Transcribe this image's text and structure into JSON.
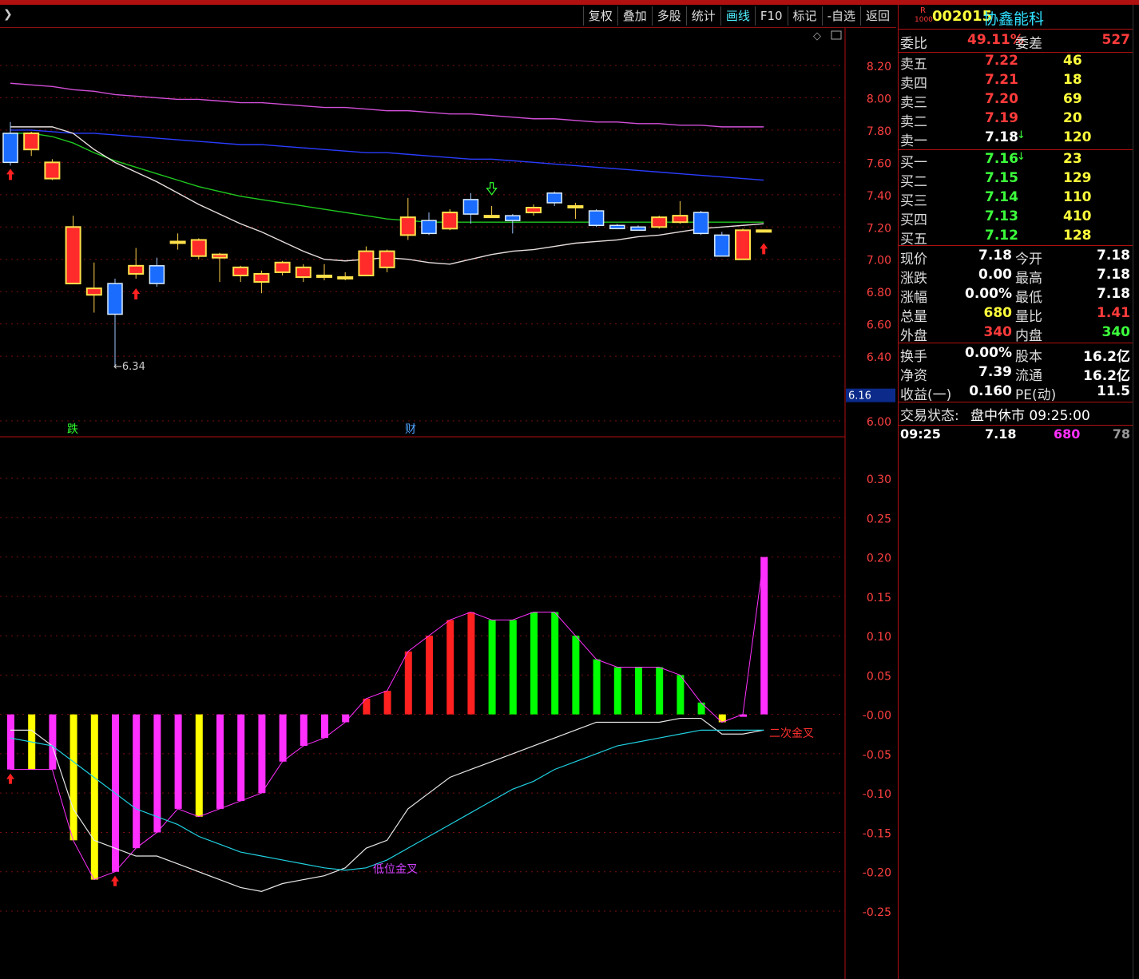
{
  "toolbar": {
    "buttons": [
      "复权",
      "叠加",
      "多股",
      "统计",
      "画线",
      "F10",
      "标记",
      "-自选",
      "返回"
    ],
    "active_index": 4
  },
  "stock": {
    "badge_top": "R",
    "badge_bottom": "1000",
    "code": "002015",
    "name": "协鑫能科"
  },
  "quote": {
    "weibi_label": "委比",
    "weibi": "49.11%",
    "weicha_label": "委差",
    "weicha": "527",
    "asks": [
      {
        "label": "卖五",
        "price": "7.22",
        "vol": "46"
      },
      {
        "label": "卖四",
        "price": "7.21",
        "vol": "18"
      },
      {
        "label": "卖三",
        "price": "7.20",
        "vol": "69"
      },
      {
        "label": "卖二",
        "price": "7.19",
        "vol": "20"
      },
      {
        "label": "卖一",
        "price": "7.18",
        "vol": "120"
      }
    ],
    "bids": [
      {
        "label": "买一",
        "price": "7.16",
        "vol": "23"
      },
      {
        "label": "买二",
        "price": "7.15",
        "vol": "129"
      },
      {
        "label": "买三",
        "price": "7.14",
        "vol": "110"
      },
      {
        "label": "买四",
        "price": "7.13",
        "vol": "410"
      },
      {
        "label": "买五",
        "price": "7.12",
        "vol": "128"
      }
    ],
    "stats1": [
      {
        "l1": "现价",
        "v1": "7.18",
        "c1": "white",
        "l2": "今开",
        "v2": "7.18",
        "c2": "white"
      },
      {
        "l1": "涨跌",
        "v1": "0.00",
        "c1": "white",
        "l2": "最高",
        "v2": "7.18",
        "c2": "white"
      },
      {
        "l1": "涨幅",
        "v1": "0.00%",
        "c1": "white",
        "l2": "最低",
        "v2": "7.18",
        "c2": "white"
      },
      {
        "l1": "总量",
        "v1": "680",
        "c1": "yellow",
        "l2": "量比",
        "v2": "1.41",
        "c2": "red"
      },
      {
        "l1": "外盘",
        "v1": "340",
        "c1": "red",
        "l2": "内盘",
        "v2": "340",
        "c2": "green"
      }
    ],
    "stats2": [
      {
        "l1": "换手",
        "v1": "0.00%",
        "c1": "white",
        "l2": "股本",
        "v2": "16.2亿",
        "c2": "white"
      },
      {
        "l1": "净资",
        "v1": "7.39",
        "c1": "white",
        "l2": "流通",
        "v2": "16.2亿",
        "c2": "white"
      },
      {
        "l1": "收益(一)",
        "v1": "0.160",
        "c1": "white",
        "l2": "PE(动)",
        "v2": "11.5",
        "c2": "white"
      }
    ],
    "status_label": "交易状态:",
    "status_value": "盘中休市 09:25:00",
    "tick": {
      "time": "09:25",
      "price": "7.18",
      "vol": "680",
      "num": "78"
    }
  },
  "chart_data": [
    {
      "type": "candlestick",
      "ylim": [
        5.95,
        8.35
      ],
      "yticks": [
        "8.20",
        "8.00",
        "7.80",
        "7.60",
        "7.40",
        "7.20",
        "7.00",
        "6.80",
        "6.60",
        "6.40",
        "6.16",
        "6.00"
      ],
      "current_price_label": "6.16",
      "low_annotation": "6.34",
      "markers": [
        "跌",
        "财"
      ],
      "candles": [
        {
          "o": 7.78,
          "c": 7.6,
          "h": 7.85,
          "l": 7.58
        },
        {
          "o": 7.68,
          "c": 7.78,
          "h": 7.79,
          "l": 7.64
        },
        {
          "o": 7.5,
          "c": 7.6,
          "h": 7.62,
          "l": 7.49
        },
        {
          "o": 6.85,
          "c": 7.2,
          "h": 7.27,
          "l": 6.85
        },
        {
          "o": 6.78,
          "c": 6.82,
          "h": 6.98,
          "l": 6.67
        },
        {
          "o": 6.85,
          "c": 6.66,
          "h": 6.88,
          "l": 6.34
        },
        {
          "o": 6.91,
          "c": 6.96,
          "h": 7.07,
          "l": 6.88
        },
        {
          "o": 6.96,
          "c": 6.85,
          "h": 7.01,
          "l": 6.83
        },
        {
          "o": 7.11,
          "c": 7.11,
          "h": 7.16,
          "l": 7.06
        },
        {
          "o": 7.02,
          "c": 7.12,
          "h": 7.13,
          "l": 7.0
        },
        {
          "o": 7.01,
          "c": 7.03,
          "h": 7.04,
          "l": 6.86
        },
        {
          "o": 6.9,
          "c": 6.95,
          "h": 6.96,
          "l": 6.86
        },
        {
          "o": 6.86,
          "c": 6.91,
          "h": 6.93,
          "l": 6.79
        },
        {
          "o": 6.92,
          "c": 6.98,
          "h": 6.99,
          "l": 6.9
        },
        {
          "o": 6.89,
          "c": 6.95,
          "h": 6.97,
          "l": 6.86
        },
        {
          "o": 6.9,
          "c": 6.9,
          "h": 6.97,
          "l": 6.87
        },
        {
          "o": 6.89,
          "c": 6.89,
          "h": 6.92,
          "l": 6.87
        },
        {
          "o": 6.9,
          "c": 7.05,
          "h": 7.08,
          "l": 6.9
        },
        {
          "o": 6.95,
          "c": 7.05,
          "h": 7.06,
          "l": 6.92
        },
        {
          "o": 7.15,
          "c": 7.26,
          "h": 7.38,
          "l": 7.12
        },
        {
          "o": 7.24,
          "c": 7.16,
          "h": 7.29,
          "l": 7.15
        },
        {
          "o": 7.19,
          "c": 7.29,
          "h": 7.31,
          "l": 7.18
        },
        {
          "o": 7.37,
          "c": 7.28,
          "h": 7.41,
          "l": 7.22
        },
        {
          "o": 7.27,
          "c": 7.27,
          "h": 7.33,
          "l": 7.26
        },
        {
          "o": 7.27,
          "c": 7.24,
          "h": 7.28,
          "l": 7.16
        },
        {
          "o": 7.29,
          "c": 7.32,
          "h": 7.34,
          "l": 7.27
        },
        {
          "o": 7.41,
          "c": 7.35,
          "h": 7.42,
          "l": 7.33
        },
        {
          "o": 7.33,
          "c": 7.33,
          "h": 7.35,
          "l": 7.25
        },
        {
          "o": 7.3,
          "c": 7.21,
          "h": 7.31,
          "l": 7.2
        },
        {
          "o": 7.21,
          "c": 7.19,
          "h": 7.22,
          "l": 7.19
        },
        {
          "o": 7.2,
          "c": 7.18,
          "h": 7.21,
          "l": 7.18
        },
        {
          "o": 7.2,
          "c": 7.26,
          "h": 7.27,
          "l": 7.19
        },
        {
          "o": 7.23,
          "c": 7.27,
          "h": 7.36,
          "l": 7.22
        },
        {
          "o": 7.29,
          "c": 7.16,
          "h": 7.3,
          "l": 7.15
        },
        {
          "o": 7.15,
          "c": 7.02,
          "h": 7.17,
          "l": 7.02
        },
        {
          "o": 7.0,
          "c": 7.18,
          "h": 7.19,
          "l": 7.0
        },
        {
          "o": 7.18,
          "c": 7.18,
          "h": 7.18,
          "l": 7.18
        }
      ],
      "ma_magenta": [
        8.09,
        8.08,
        8.07,
        8.05,
        8.04,
        8.02,
        8.01,
        8.0,
        7.99,
        7.99,
        7.98,
        7.97,
        7.97,
        7.96,
        7.95,
        7.94,
        7.94,
        7.93,
        7.92,
        7.92,
        7.91,
        7.9,
        7.9,
        7.89,
        7.88,
        7.87,
        7.87,
        7.86,
        7.85,
        7.85,
        7.84,
        7.84,
        7.83,
        7.83,
        7.82,
        7.82,
        7.82
      ],
      "ma_blue": [
        7.8,
        7.8,
        7.79,
        7.78,
        7.78,
        7.77,
        7.76,
        7.75,
        7.74,
        7.73,
        7.72,
        7.71,
        7.71,
        7.7,
        7.69,
        7.68,
        7.67,
        7.66,
        7.66,
        7.65,
        7.64,
        7.63,
        7.62,
        7.62,
        7.61,
        7.6,
        7.59,
        7.58,
        7.57,
        7.56,
        7.55,
        7.54,
        7.53,
        7.52,
        7.51,
        7.5,
        7.49
      ],
      "ma_green": [
        7.78,
        7.78,
        7.76,
        7.72,
        7.66,
        7.61,
        7.57,
        7.53,
        7.49,
        7.45,
        7.42,
        7.39,
        7.37,
        7.35,
        7.33,
        7.31,
        7.29,
        7.27,
        7.25,
        7.24,
        7.23,
        7.23,
        7.23,
        7.23,
        7.23,
        7.23,
        7.23,
        7.23,
        7.23,
        7.23,
        7.23,
        7.23,
        7.23,
        7.23,
        7.23,
        7.23,
        7.23
      ],
      "ma_white": [
        7.82,
        7.82,
        7.82,
        7.78,
        7.68,
        7.6,
        7.54,
        7.48,
        7.41,
        7.34,
        7.28,
        7.22,
        7.17,
        7.11,
        7.05,
        7.0,
        6.99,
        7.0,
        7.01,
        7.0,
        6.98,
        6.97,
        7.0,
        7.03,
        7.05,
        7.06,
        7.08,
        7.1,
        7.11,
        7.12,
        7.14,
        7.15,
        7.17,
        7.19,
        7.2,
        7.21,
        7.22
      ]
    },
    {
      "type": "bar",
      "ylim": [
        -0.28,
        0.35
      ],
      "yticks": [
        "0.30",
        "0.25",
        "0.20",
        "0.15",
        "0.10",
        "0.05",
        "-0.00",
        "-0.05",
        "-0.10",
        "-0.15",
        "-0.20",
        "-0.25"
      ],
      "annotations": [
        "低位金叉",
        "二次金叉"
      ],
      "bars": [
        {
          "v": -0.07,
          "c": "#ff30ff"
        },
        {
          "v": -0.07,
          "c": "#ffff00"
        },
        {
          "v": -0.07,
          "c": "#ff30ff"
        },
        {
          "v": -0.16,
          "c": "#ffff00"
        },
        {
          "v": -0.21,
          "c": "#ffff00"
        },
        {
          "v": -0.2,
          "c": "#ff30ff"
        },
        {
          "v": -0.17,
          "c": "#ff30ff"
        },
        {
          "v": -0.15,
          "c": "#ff30ff"
        },
        {
          "v": -0.12,
          "c": "#ff30ff"
        },
        {
          "v": -0.13,
          "c": "#ffff00"
        },
        {
          "v": -0.12,
          "c": "#ff30ff"
        },
        {
          "v": -0.11,
          "c": "#ff30ff"
        },
        {
          "v": -0.1,
          "c": "#ff30ff"
        },
        {
          "v": -0.06,
          "c": "#ff30ff"
        },
        {
          "v": -0.04,
          "c": "#ff30ff"
        },
        {
          "v": -0.03,
          "c": "#ff30ff"
        },
        {
          "v": -0.01,
          "c": "#ff30ff"
        },
        {
          "v": 0.02,
          "c": "#ff2020"
        },
        {
          "v": 0.03,
          "c": "#ff2020"
        },
        {
          "v": 0.08,
          "c": "#ff2020"
        },
        {
          "v": 0.1,
          "c": "#ff2020"
        },
        {
          "v": 0.12,
          "c": "#ff2020"
        },
        {
          "v": 0.13,
          "c": "#ff2020"
        },
        {
          "v": 0.12,
          "c": "#00ff00"
        },
        {
          "v": 0.12,
          "c": "#00ff00"
        },
        {
          "v": 0.13,
          "c": "#00ff00"
        },
        {
          "v": 0.13,
          "c": "#00ff00"
        },
        {
          "v": 0.1,
          "c": "#00ff00"
        },
        {
          "v": 0.07,
          "c": "#00ff00"
        },
        {
          "v": 0.06,
          "c": "#00ff00"
        },
        {
          "v": 0.06,
          "c": "#00ff00"
        },
        {
          "v": 0.06,
          "c": "#00ff00"
        },
        {
          "v": 0.05,
          "c": "#00ff00"
        },
        {
          "v": 0.015,
          "c": "#00ff00"
        },
        {
          "v": -0.01,
          "c": "#ffff00"
        },
        {
          "v": 0.0,
          "c": "#ff30ff"
        },
        {
          "v": 0.2,
          "c": "#ff30ff"
        }
      ],
      "line_white": [
        -0.02,
        -0.02,
        -0.04,
        -0.12,
        -0.16,
        -0.17,
        -0.18,
        -0.18,
        -0.19,
        -0.2,
        -0.21,
        -0.22,
        -0.225,
        -0.215,
        -0.21,
        -0.205,
        -0.195,
        -0.17,
        -0.16,
        -0.12,
        -0.1,
        -0.08,
        -0.07,
        -0.06,
        -0.05,
        -0.04,
        -0.03,
        -0.02,
        -0.01,
        -0.01,
        -0.01,
        -0.01,
        -0.005,
        -0.005,
        -0.025,
        -0.025,
        -0.02
      ],
      "line_cyan": [
        -0.03,
        -0.035,
        -0.04,
        -0.06,
        -0.08,
        -0.1,
        -0.12,
        -0.13,
        -0.14,
        -0.155,
        -0.165,
        -0.175,
        -0.18,
        -0.185,
        -0.19,
        -0.195,
        -0.198,
        -0.195,
        -0.185,
        -0.17,
        -0.155,
        -0.14,
        -0.125,
        -0.11,
        -0.095,
        -0.085,
        -0.07,
        -0.06,
        -0.05,
        -0.04,
        -0.035,
        -0.03,
        -0.025,
        -0.02,
        -0.02,
        -0.02,
        -0.02
      ]
    }
  ]
}
